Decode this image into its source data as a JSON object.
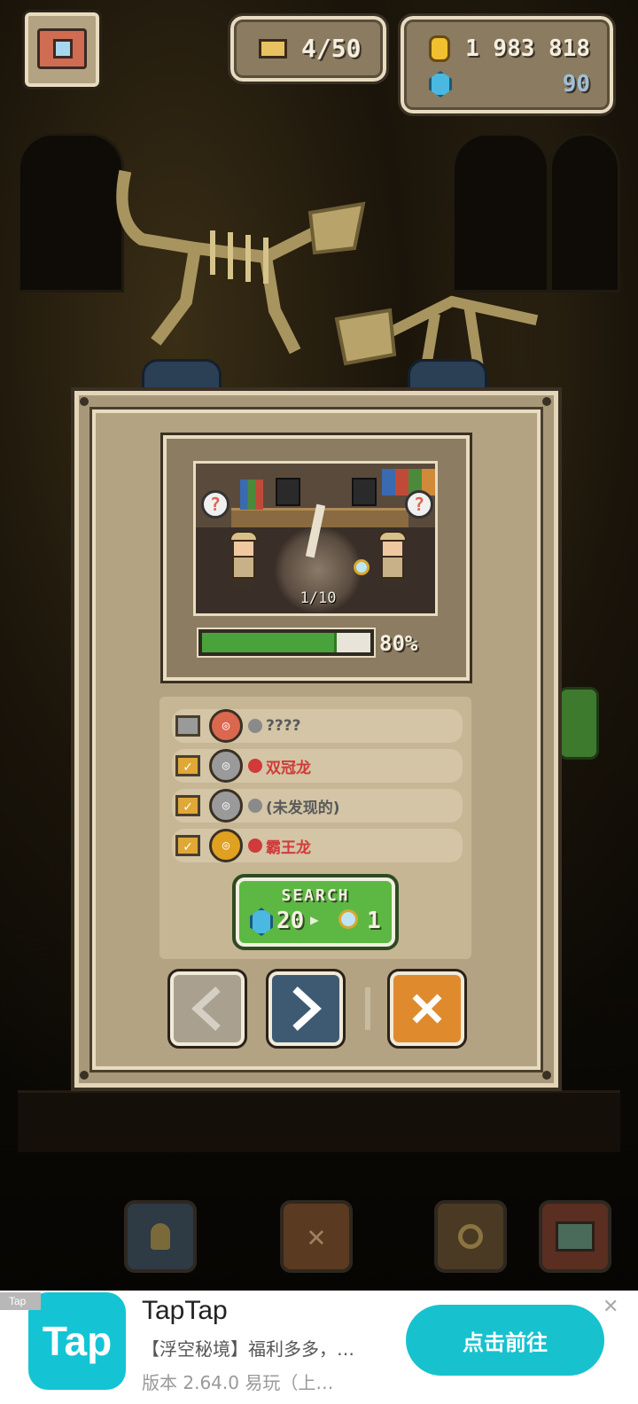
{
  "hud": {
    "capacity": "4/50",
    "coins": "1 983 818",
    "gems": "90"
  },
  "scene": {
    "counter": "1/10",
    "left_bubble": "?",
    "right_bubble": "?"
  },
  "progress": {
    "fraction": 0.8,
    "label": "80%"
  },
  "dino_list": [
    {
      "name": "????",
      "checked": false,
      "medal_color": "#d9684f",
      "dot_color": "#8a8a8a",
      "name_color": "#5a5a5a"
    },
    {
      "name": "双冠龙",
      "checked": true,
      "medal_color": "#9a9a9a",
      "dot_color": "#d03a3a",
      "name_color": "#d03a3a"
    },
    {
      "name": "(未发现的)",
      "checked": true,
      "medal_color": "#9a9a9a",
      "dot_color": "#8a8a8a",
      "name_color": "#5a5a5a"
    },
    {
      "name": "霸王龙",
      "checked": true,
      "medal_color": "#e0a020",
      "dot_color": "#d03a3a",
      "name_color": "#d03a3a"
    }
  ],
  "search": {
    "label": "SEARCH",
    "gem_cost": "20",
    "lens_cost": "1"
  },
  "nav": {
    "prev_icon": "chevron-left-icon",
    "next_icon": "chevron-right-icon",
    "close_icon": "close-icon"
  },
  "ad": {
    "tag": "Tap",
    "logo_text": "Tap",
    "title": "TapTap",
    "subtitle": "【浮空秘境】福利多多，…",
    "version": "版本 2.64.0  易玩（上…",
    "cta": "点击前往",
    "close": "✕"
  },
  "colors": {
    "accent_green": "#49a33a",
    "frame_light": "#e8dcc0",
    "frame_dark": "#3a3024",
    "ad_teal": "#17c2ce",
    "close_orange": "#e08a2e",
    "next_blue": "#3e5a72"
  }
}
